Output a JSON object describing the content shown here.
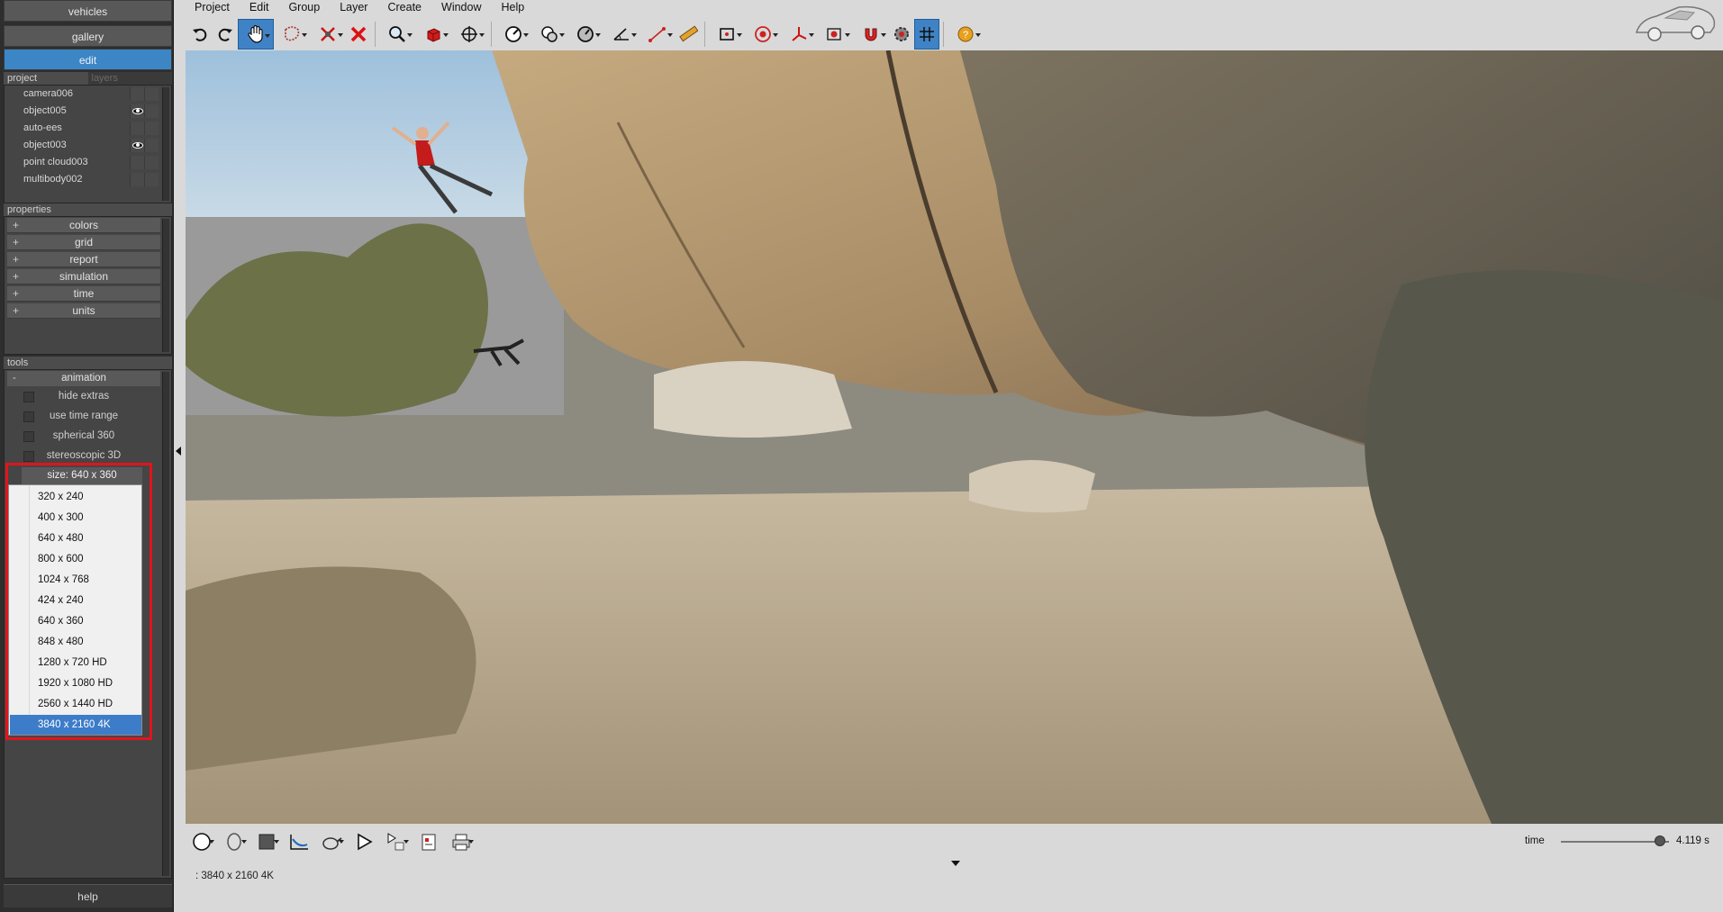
{
  "left_panel": {
    "nav": [
      "vehicles",
      "gallery",
      "edit"
    ],
    "project_tabs": [
      "project",
      "layers"
    ],
    "layers": [
      {
        "name": "camera006",
        "visible_icon": false
      },
      {
        "name": "object005",
        "visible_icon": true
      },
      {
        "name": "auto-ees",
        "visible_icon": false
      },
      {
        "name": "object003",
        "visible_icon": true
      },
      {
        "name": "point cloud003",
        "visible_icon": false
      },
      {
        "name": "multibody002",
        "visible_icon": false
      }
    ],
    "properties_header": "properties",
    "properties": [
      "colors",
      "grid",
      "report",
      "simulation",
      "time",
      "units"
    ],
    "tools_header": "tools",
    "tools_group": "animation",
    "tools": [
      "hide extras",
      "use time range",
      "spherical 360",
      "stereoscopic 3D"
    ],
    "size_label": "size: 640 x 360",
    "size_options": [
      "320 x 240",
      "400 x 300",
      "640 x 480",
      "800 x 600",
      "1024 x 768",
      "424 x 240",
      "640 x 360",
      "848 x 480",
      "1280 x 720 HD",
      "1920 x 1080 HD",
      "2560 x 1440 HD",
      "3840 x 2160 4K"
    ],
    "size_selected": "3840 x 2160 4K",
    "help": "help"
  },
  "menu": [
    "Project",
    "Edit",
    "Group",
    "Layer",
    "Create",
    "Window",
    "Help"
  ],
  "toolbar_icons": [
    "undo-icon",
    "redo-icon",
    "pan-hand-icon",
    "lasso-icon",
    "delete-joint-icon",
    "delete-icon",
    "zoom-icon",
    "cube-icon",
    "move-icon",
    "speedometer-icon",
    "clock-gear-icon",
    "gauge-icon",
    "angle-icon",
    "measure-icon",
    "ruler-icon",
    "camera-frame-icon",
    "target-icon",
    "axes-icon",
    "record-icon",
    "magnet-icon",
    "settings-gear-icon",
    "grid-icon",
    "help-icon"
  ],
  "bottom_icons": [
    "sphere-icon",
    "head-icon",
    "color-square-icon",
    "graph-icon",
    "teapot-icon",
    "play-icon",
    "playlist-icon",
    "report-icon",
    "print-icon"
  ],
  "time": {
    "label": "time",
    "value": "4.119 s",
    "slider_fraction": 0.92
  },
  "status": ": 3840 x 2160 4K",
  "colors": {
    "accent": "#3d86c6",
    "highlight": "#e0141c",
    "panel": "#2e2e2e"
  }
}
